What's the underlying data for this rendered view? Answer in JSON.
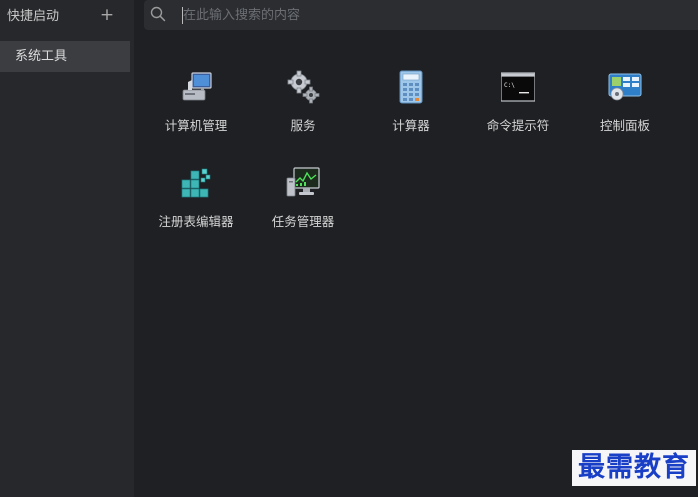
{
  "sidebar": {
    "title": "快捷启动",
    "add_label": "+",
    "items": [
      {
        "label": "系统工具"
      }
    ]
  },
  "search": {
    "placeholder": "在此输入搜索的内容",
    "value": ""
  },
  "tools": [
    {
      "label": "计算机管理",
      "icon": "computer-management-icon"
    },
    {
      "label": "服务",
      "icon": "services-gears-icon"
    },
    {
      "label": "计算器",
      "icon": "calculator-icon"
    },
    {
      "label": "命令提示符",
      "icon": "command-prompt-icon"
    },
    {
      "label": "控制面板",
      "icon": "control-panel-icon"
    },
    {
      "label": "注册表编辑器",
      "icon": "registry-editor-icon"
    },
    {
      "label": "任务管理器",
      "icon": "task-manager-icon"
    }
  ],
  "watermark": "最需教育",
  "colors": {
    "background": "#1e2023",
    "sidebar": "#26282b",
    "selected_item": "#3b3d41",
    "watermark": "#1a3fc7"
  }
}
